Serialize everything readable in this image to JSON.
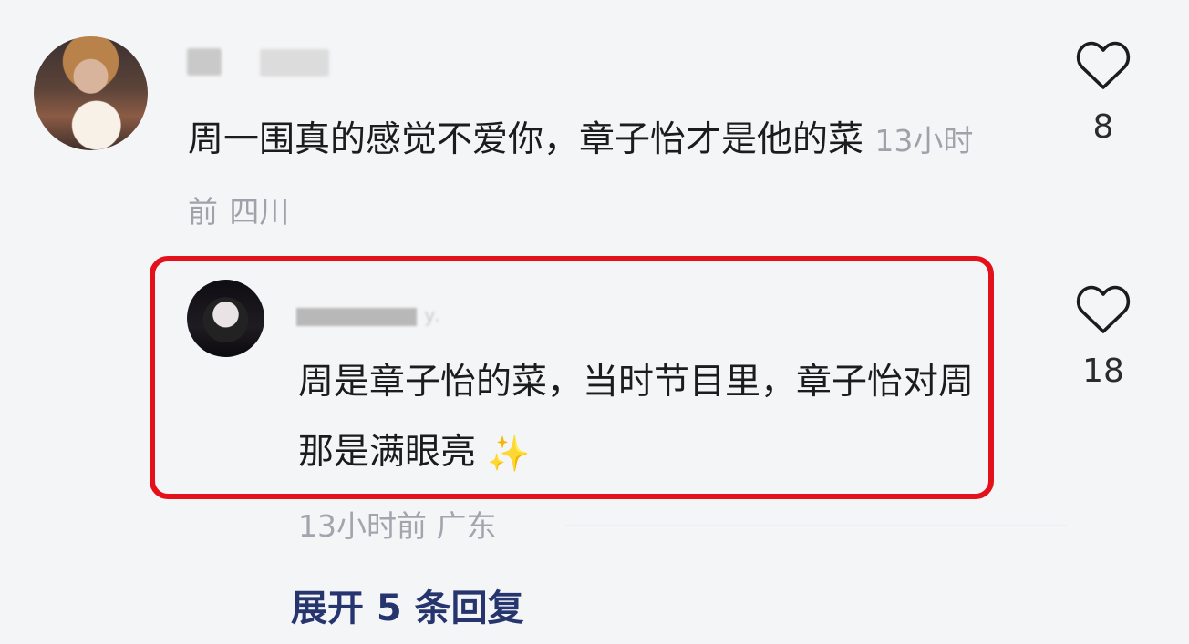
{
  "comment": {
    "text": "周一围真的感觉不爱你，章子怡才是他的菜",
    "time": "13小时前",
    "location": "四川",
    "likes": "8"
  },
  "reply": {
    "username_visible": "y.",
    "text": "周是章子怡的菜，当时节目里，章子怡对周那是满眼亮",
    "emoji": "✨",
    "time": "13小时前",
    "location": "广东",
    "likes": "18"
  },
  "expand_replies": {
    "label": "展开 5 条回复"
  },
  "icons": {
    "like": "heart-icon",
    "emoji": "sparkles-icon"
  },
  "colors": {
    "highlight_border": "#e4111a",
    "expand_link": "#26356e",
    "meta_text": "#9ea3ab"
  }
}
